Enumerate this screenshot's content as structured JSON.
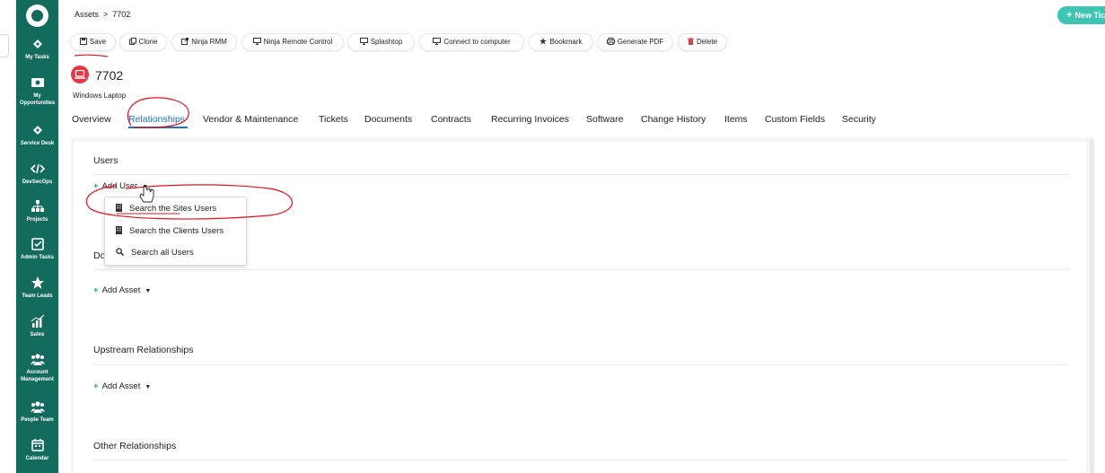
{
  "sidebar": {
    "items": [
      {
        "label": "My Tasks",
        "icon": "ticket-icon"
      },
      {
        "label": "My Opportunities",
        "icon": "money-icon"
      },
      {
        "label": "Service Desk",
        "icon": "ticket-icon"
      },
      {
        "label": "DevSecOps",
        "icon": "code-icon"
      },
      {
        "label": "Projects",
        "icon": "hierarchy-icon"
      },
      {
        "label": "Admin Tasks",
        "icon": "checkbox-icon"
      },
      {
        "label": "Team Leads",
        "icon": "star-icon"
      },
      {
        "label": "Sales",
        "icon": "chart-icon"
      },
      {
        "label": "Account Management",
        "icon": "users-icon"
      },
      {
        "label": "People Team",
        "icon": "users-icon"
      },
      {
        "label": "Calendar",
        "icon": "calendar-icon"
      }
    ]
  },
  "breadcrumb": {
    "root": "Assets",
    "separator": ">",
    "current": "7702"
  },
  "header": {
    "new_ticket": "New Ticket"
  },
  "toolbar": {
    "buttons": [
      "Save",
      "Clone",
      "Ninja RMM",
      "Ninja Remote Control",
      "Splashtop",
      "Connect to computer",
      "Bookmark",
      "Generate PDF",
      "Delete"
    ]
  },
  "asset": {
    "number": "7702",
    "type": "Windows Laptop"
  },
  "tabs": [
    "Overview",
    "Relationships",
    "Vendor & Maintenance",
    "Tickets",
    "Documents",
    "Contracts",
    "Recurring Invoices",
    "Software",
    "Change History",
    "Items",
    "Custom Fields",
    "Security"
  ],
  "sections": {
    "users": {
      "title": "Users",
      "add": "Add User"
    },
    "downstream": {
      "title": "Do",
      "add": "Add Asset"
    },
    "upstream": {
      "title": "Upstream Relationships",
      "add": "Add Asset"
    },
    "other": {
      "title": "Other Relationships"
    }
  },
  "dropdown": {
    "items": [
      "Search the Sites Users",
      "Search the Clients Users",
      "Search all Users"
    ]
  },
  "colors": {
    "sidebar": "#136b5d",
    "accent": "#1f6fc5",
    "danger": "#e53946",
    "add_plus": "#2f9e44",
    "annotation": "#e0141e"
  }
}
